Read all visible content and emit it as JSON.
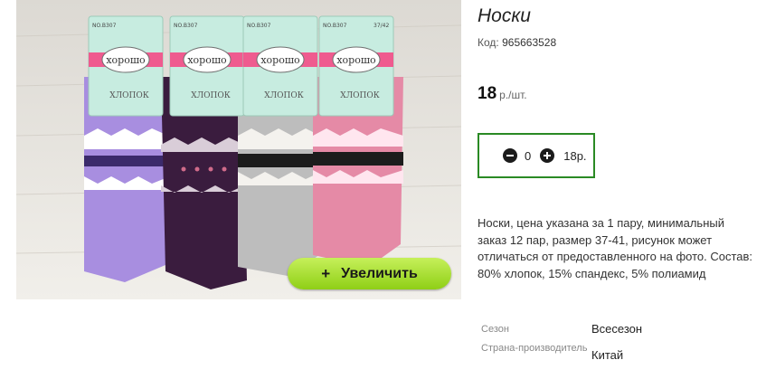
{
  "product": {
    "title": "Носки",
    "code_label": "Код:",
    "code_value": "965663528",
    "price_value": "18",
    "price_unit": "р./шт."
  },
  "gallery": {
    "zoom_plus": "+",
    "zoom_label": "Увеличить",
    "brand": "хорошо",
    "sku": "NO.B307",
    "size": "37/42",
    "material": "ХЛОПОК"
  },
  "quantity": {
    "value": "0",
    "sum": "18р."
  },
  "description": "Носки, цена указана за 1 пару, минимальный заказ 12 пар, размер 37-41, рисунок может отличаться от предоставленного на фото. Состав: 80% хлопок, 15% спандекс, 5% полиамид",
  "properties": [
    {
      "label": "Сезон",
      "value": "Всесезон"
    },
    {
      "label": "Страна-производитель",
      "value": "Китай"
    }
  ],
  "colors": {
    "sock_1": "#a88ee0",
    "sock_2": "#3a1c3e",
    "sock_3": "#bdbdbd",
    "sock_4": "#e58aa6",
    "label_green": "#c7ece0",
    "ribbon_pink": "#ef5b8f",
    "qty_border": "#2a8a24",
    "zoom_button": "#a6de2a"
  }
}
